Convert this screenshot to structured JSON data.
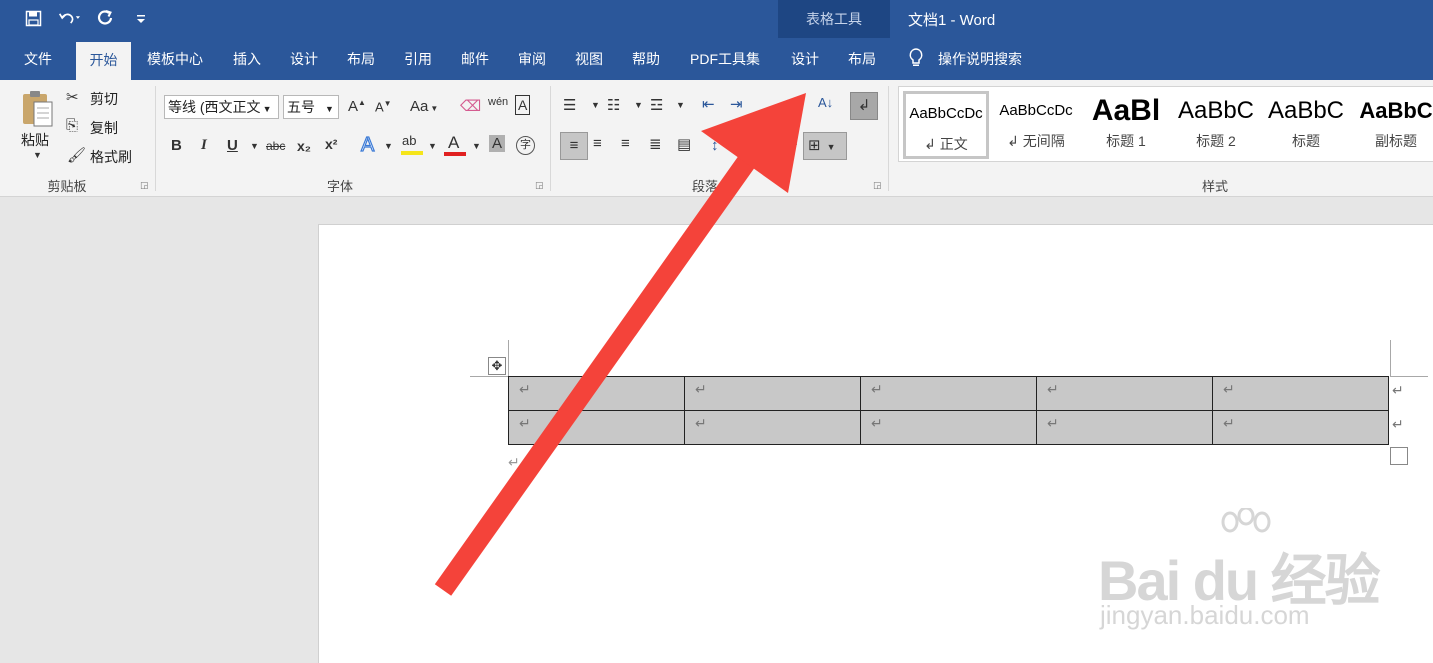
{
  "window": {
    "context_title": "表格工具",
    "doc_title": "文档1  -  Word"
  },
  "quick_access": {
    "icons": [
      "save-icon",
      "undo-icon",
      "redo-icon",
      "customize-icon"
    ]
  },
  "tabs": [
    {
      "label": "文件"
    },
    {
      "label": "开始",
      "active": true
    },
    {
      "label": "模板中心"
    },
    {
      "label": "插入"
    },
    {
      "label": "设计"
    },
    {
      "label": "布局"
    },
    {
      "label": "引用"
    },
    {
      "label": "邮件"
    },
    {
      "label": "审阅"
    },
    {
      "label": "视图"
    },
    {
      "label": "帮助"
    },
    {
      "label": "PDF工具集"
    },
    {
      "label": "设计"
    },
    {
      "label": "布局"
    }
  ],
  "tell_me": {
    "label": "操作说明搜索"
  },
  "clipboard": {
    "paste": "粘贴",
    "cut": "剪切",
    "copy": "复制",
    "format_painter": "格式刷",
    "group_label": "剪贴板"
  },
  "font": {
    "font_name": "等线 (西文正文",
    "font_size": "五号",
    "grow": "A",
    "shrink": "A",
    "change_case": "Aa",
    "bold": "B",
    "italic": "I",
    "underline": "U",
    "strikethrough": "abc",
    "subscript": "x₂",
    "superscript": "x²",
    "text_effects": "A",
    "font_color": "A",
    "char_shading": "A",
    "char_border": "A",
    "phonetic": "wén",
    "enclose": "字",
    "group_label": "字体"
  },
  "paragraph": {
    "group_label": "段落"
  },
  "styles": {
    "items": [
      {
        "sample": "AaBbCcDc",
        "name": "↲ 正文",
        "selected": true
      },
      {
        "sample": "AaBbCcDc",
        "name": "↲ 无间隔"
      },
      {
        "sample": "AaBl",
        "name": "标题 1"
      },
      {
        "sample": "AaBbC",
        "name": "标题 2"
      },
      {
        "sample": "AaBbC",
        "name": "标题"
      },
      {
        "sample": "AaBbC",
        "name": "副标题"
      }
    ],
    "group_label": "样式"
  },
  "document": {
    "table": {
      "rows": 2,
      "cols": 5,
      "cell_mark": "↵"
    },
    "paragraph_mark": "↵",
    "move_handle": "✥"
  },
  "watermark": {
    "main": "Bai du 经验",
    "sub": "jingyan.baidu.com"
  },
  "annotation": {
    "arrow_color": "#f4433a"
  },
  "colors": {
    "title_bar": "#2b579a",
    "context_band": "#1e4683",
    "ribbon": "#f3f3f3"
  }
}
